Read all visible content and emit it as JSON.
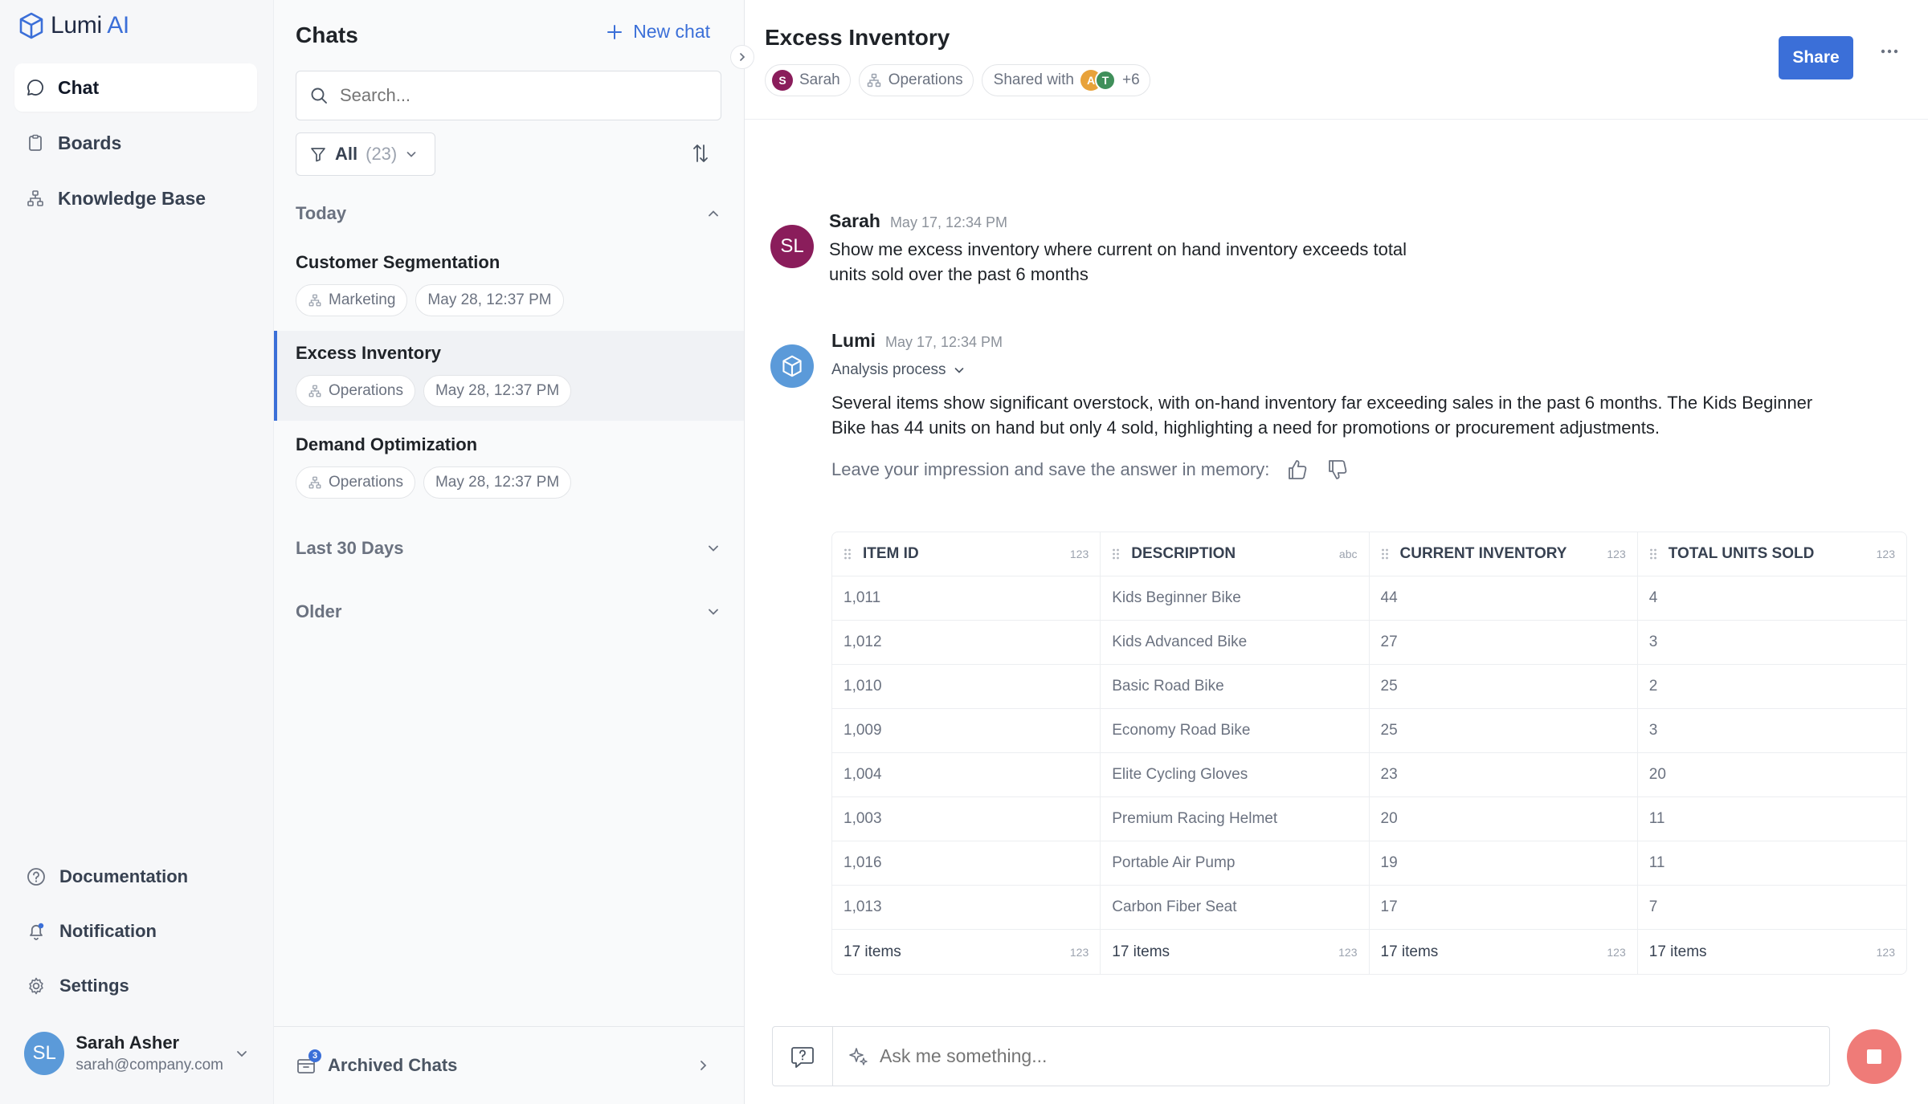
{
  "app": {
    "logo_text": "Lumi",
    "logo_ai": "AI"
  },
  "sidebar": {
    "items": [
      {
        "label": "Chat",
        "icon": "chat-bubble-icon"
      },
      {
        "label": "Boards",
        "icon": "clipboard-icon"
      },
      {
        "label": "Knowledge Base",
        "icon": "hierarchy-icon"
      }
    ],
    "bottom_items": [
      {
        "label": "Documentation",
        "icon": "help-circle-icon"
      },
      {
        "label": "Notification",
        "icon": "bell-icon"
      },
      {
        "label": "Settings",
        "icon": "gear-icon"
      }
    ],
    "user": {
      "initials": "SL",
      "name": "Sarah Asher",
      "email": "sarah@company.com"
    }
  },
  "chats": {
    "title": "Chats",
    "new_chat_label": "New chat",
    "search_placeholder": "Search...",
    "filter": {
      "label": "All",
      "count": "(23)"
    },
    "sections": {
      "today": "Today",
      "last30": "Last 30 Days",
      "older": "Older"
    },
    "items": [
      {
        "title": "Customer Segmentation",
        "tag": "Marketing",
        "date": "May 28, 12:37 PM"
      },
      {
        "title": "Excess Inventory",
        "tag": "Operations",
        "date": "May 28, 12:37 PM"
      },
      {
        "title": "Demand Optimization",
        "tag": "Operations",
        "date": "May 28, 12:37 PM"
      }
    ],
    "archived": {
      "label": "Archived Chats",
      "badge": "3"
    }
  },
  "conversation": {
    "title": "Excess Inventory",
    "owner": {
      "initial": "S",
      "name": "Sarah"
    },
    "team": "Operations",
    "shared": {
      "label": "Shared with",
      "avatars": [
        "A",
        "T"
      ],
      "more": "+6"
    },
    "share_label": "Share",
    "messages": {
      "user": {
        "initials": "SL",
        "name": "Sarah",
        "time": "May 17, 12:34 PM",
        "line1": "Show me excess inventory where current on hand inventory exceeds total",
        "line2": "units sold over the past 6 months"
      },
      "bot": {
        "name": "Lumi",
        "time": "May 17, 12:34 PM",
        "analysis_label": "Analysis process",
        "line1": "Several items show significant overstock, with on-hand inventory far exceeding sales in the past 6 months. The Kids Beginner",
        "line2": "Bike has 44 units on hand but only 4 sold, highlighting a need for promotions or procurement adjustments.",
        "impression_label": "Leave your impression and save the answer in memory:"
      }
    },
    "table": {
      "columns": [
        {
          "label": "ITEM ID",
          "type": "123"
        },
        {
          "label": "DESCRIPTION",
          "type": "abc"
        },
        {
          "label": "CURRENT INVENTORY",
          "type": "123"
        },
        {
          "label": "TOTAL UNITS SOLD",
          "type": "123"
        }
      ],
      "rows": [
        [
          "1,011",
          "Kids Beginner Bike",
          "44",
          "4"
        ],
        [
          "1,012",
          "Kids Advanced Bike",
          "27",
          "3"
        ],
        [
          "1,010",
          "Basic Road Bike",
          "25",
          "2"
        ],
        [
          "1,009",
          "Economy Road Bike",
          "25",
          "3"
        ],
        [
          "1,004",
          "Elite Cycling Gloves",
          "23",
          "20"
        ],
        [
          "1,003",
          "Premium Racing Helmet",
          "20",
          "11"
        ],
        [
          "1,016",
          "Portable Air Pump",
          "19",
          "11"
        ],
        [
          "1,013",
          "Carbon Fiber Seat",
          "17",
          "7"
        ]
      ],
      "footer": [
        {
          "label": "17 items",
          "type": "123"
        },
        {
          "label": "17 items",
          "type": "123"
        },
        {
          "label": "17 items",
          "type": "123"
        },
        {
          "label": "17 items",
          "type": "123"
        }
      ]
    },
    "composer_placeholder": "Ask me something..."
  },
  "colors": {
    "accent": "#3b6fd8",
    "user_avatar": "#8a1d5b",
    "bot_avatar": "#5b9ad9",
    "stop": "#ef7b78"
  }
}
